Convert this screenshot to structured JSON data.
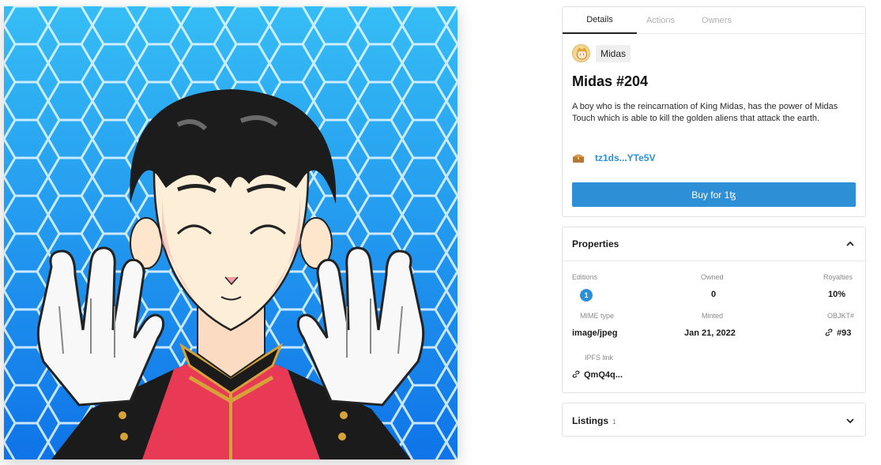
{
  "artwork": {
    "alt": "Midas #204 artwork"
  },
  "tabs": [
    {
      "label": "Details",
      "active": true
    },
    {
      "label": "Actions",
      "active": false
    },
    {
      "label": "Owners",
      "active": false
    }
  ],
  "creator": {
    "name": "Midas"
  },
  "token": {
    "title": "Midas #204",
    "description": "A boy who is the reincarnation of King Midas, has the power of Midas Touch which is able to kill the golden aliens that attack the earth.",
    "owner_address": "tz1ds...YTe5V",
    "buy_label": "Buy for 1ꜩ"
  },
  "properties": {
    "header": "Properties",
    "editions_label": "Editions",
    "editions_value": "1",
    "owned_label": "Owned",
    "owned_value": "0",
    "royalties_label": "Royalties",
    "royalties_value": "10%",
    "mime_label": "MIME type",
    "mime_value": "image/jpeg",
    "minted_label": "Minted",
    "minted_value": "Jan 21, 2022",
    "objkt_label": "OBJKT#",
    "objkt_value": "#93",
    "ipfs_label": "IPFS link",
    "ipfs_value": "QmQ4q..."
  },
  "listings": {
    "header": "Listings",
    "count": "1"
  },
  "colors": {
    "accent": "#2d8fd5",
    "art_bg": "#29a7f0"
  }
}
